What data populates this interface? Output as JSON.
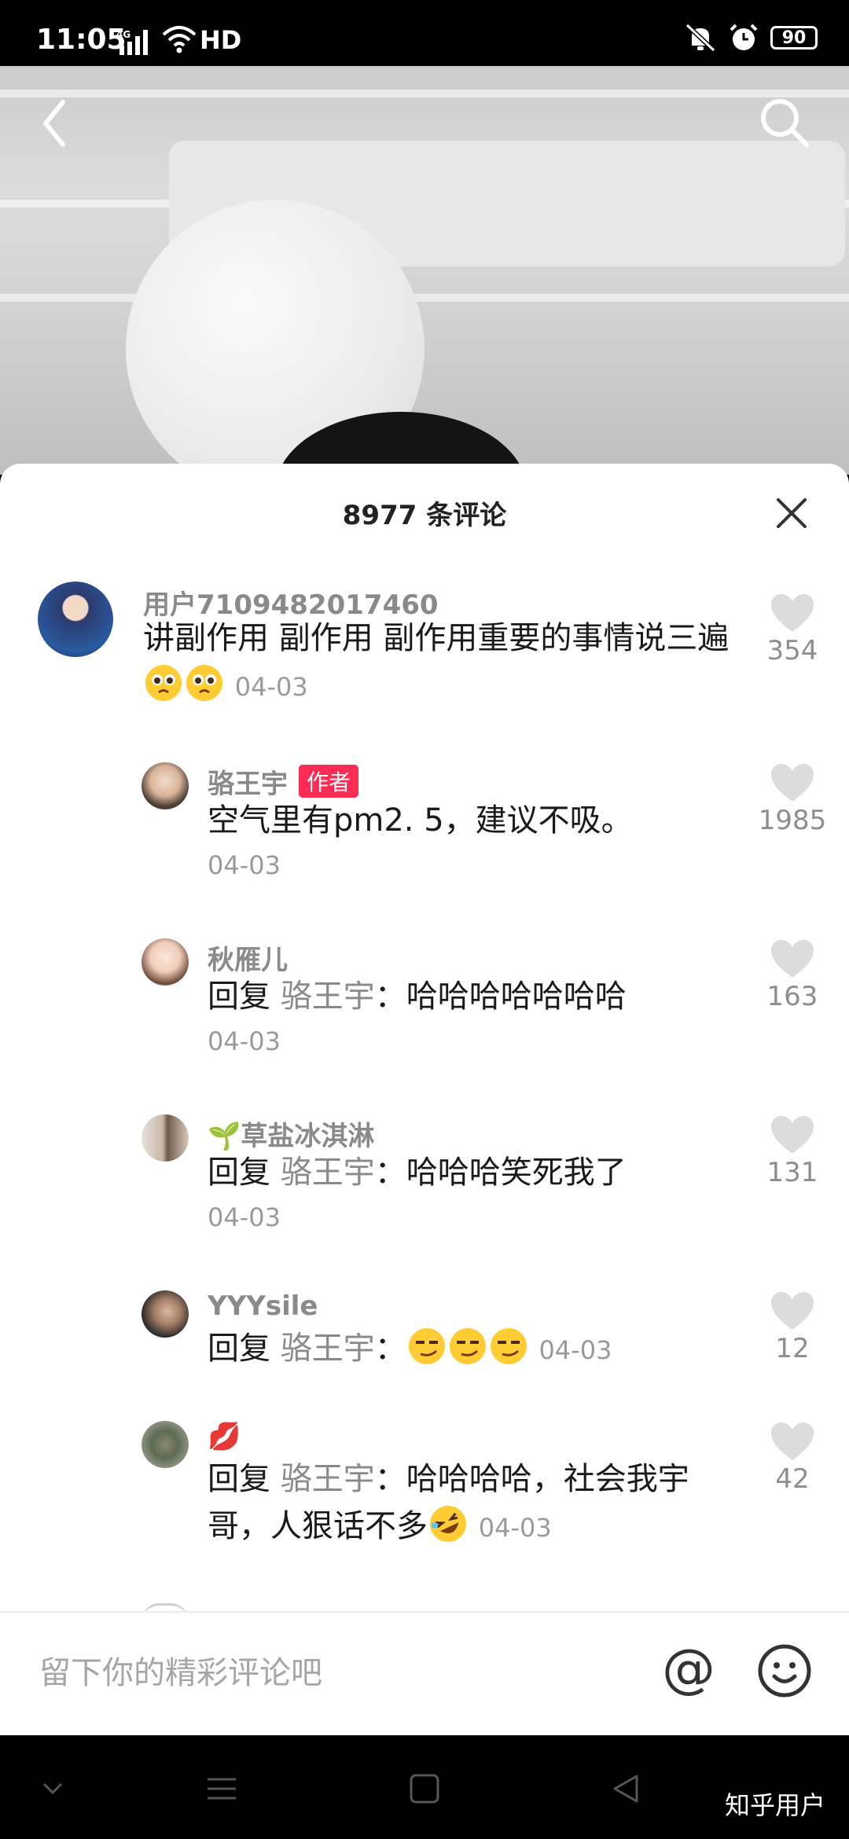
{
  "status": {
    "time": "11:05",
    "network": "4G",
    "hd": "HD",
    "battery": "90"
  },
  "header": {
    "comment_count_title": "8977 条评论"
  },
  "comments": [
    {
      "user": "用户7109482017460",
      "text": "讲副作用 副作用 副作用重要的事情说三遍",
      "date": "04-03",
      "likes": "354"
    },
    {
      "user": "骆王宇",
      "tag": "作者",
      "text": "空气里有pm2. 5，建议不吸。",
      "date": "04-03",
      "likes": "1985"
    },
    {
      "user": "秋雁儿",
      "reply_prefix": "回复",
      "reply_to": "骆王宇",
      "text": "：哈哈哈哈哈哈哈",
      "date": "04-03",
      "likes": "163"
    },
    {
      "user": "🌱草盐冰淇淋",
      "reply_prefix": "回复",
      "reply_to": "骆王宇",
      "text": "：哈哈哈笑死我了",
      "date": "04-03",
      "likes": "131"
    },
    {
      "user": "YYYsile",
      "reply_prefix": "回复",
      "reply_to": "骆王宇",
      "text": "：",
      "date": "04-03",
      "likes": "12"
    },
    {
      "user": "💋",
      "reply_prefix": "回复",
      "reply_to": "骆王宇",
      "text": "：哈哈哈哈，社会我宇哥，人狠话不多",
      "date": "04-03",
      "likes": "42"
    }
  ],
  "input": {
    "placeholder": "留下你的精彩评论吧"
  },
  "icons": {
    "at": "@",
    "emoji": "emoji-icon",
    "close": "close-icon",
    "back": "back-arrow-icon",
    "search": "search-icon"
  },
  "watermark": "知乎用户",
  "colors": {
    "author_tag": "#fe2c55",
    "accent_gray": "#8a8a8a"
  }
}
